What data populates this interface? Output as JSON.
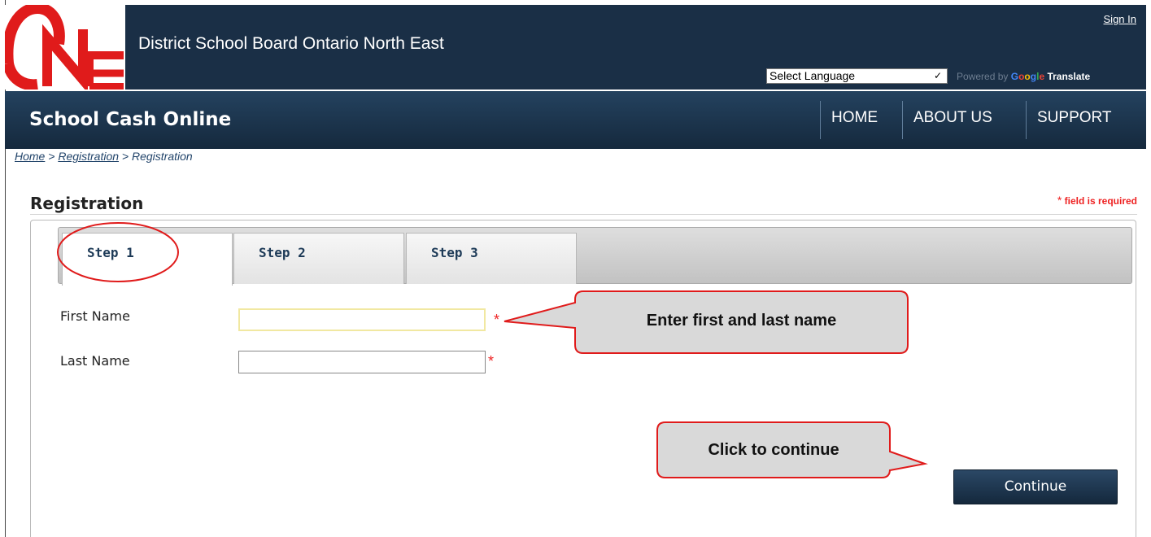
{
  "header": {
    "org_name": "District School Board Ontario North East",
    "sign_in": "Sign In",
    "language_select": "Select Language",
    "powered_by": "Powered by",
    "google": "Google",
    "translate": "Translate",
    "logo_icon": "one-logo-icon"
  },
  "nav": {
    "app_title": "School Cash Online",
    "items": [
      "HOME",
      "ABOUT US",
      "SUPPORT"
    ]
  },
  "breadcrumb": [
    "Home",
    "Registration",
    "Registration"
  ],
  "breadcrumb_separator": ">",
  "page": {
    "title": "Registration",
    "required_star": "*",
    "required_note": "field is required"
  },
  "tabs": [
    "Step 1",
    "Step 2",
    "Step 3"
  ],
  "active_tab": "Step 1",
  "form": {
    "first_name_label": "First Name",
    "first_name_value": "",
    "last_name_label": "Last Name",
    "last_name_value": "",
    "required_marker": "*",
    "continue_label": "Continue"
  },
  "callouts": {
    "name_hint": "Enter first and last name",
    "continue_hint": "Click to continue"
  },
  "colors": {
    "header_bg": "#1a2f46",
    "accent_red": "#e01b1b",
    "callout_fill": "#d9d9d9",
    "callout_stroke": "#e01b1b"
  }
}
